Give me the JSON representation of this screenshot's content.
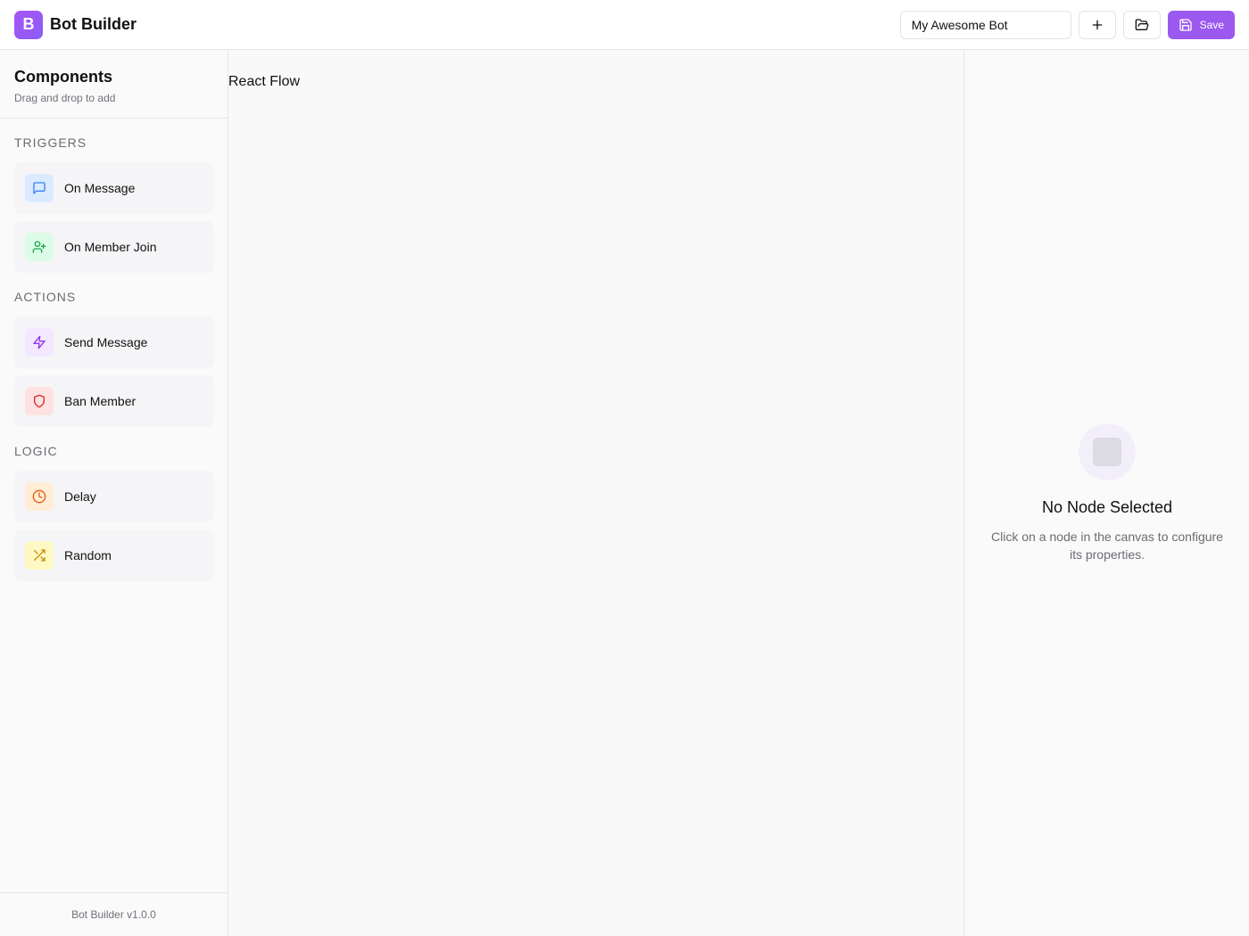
{
  "header": {
    "logo_letter": "B",
    "app_title": "Bot Builder",
    "bot_name_value": "My Awesome Bot",
    "save_label": "Save",
    "accent_color": "#9b59f0"
  },
  "sidebar": {
    "title": "Components",
    "subtitle": "Drag and drop to add",
    "sections": [
      {
        "label": "TRIGGERS",
        "items": [
          {
            "label": "On Message",
            "icon": "message-square-icon",
            "color": "#3b82f6",
            "bg": "#dbeafe"
          },
          {
            "label": "On Member Join",
            "icon": "user-plus-icon",
            "color": "#16a34a",
            "bg": "#dcfce7"
          }
        ]
      },
      {
        "label": "ACTIONS",
        "items": [
          {
            "label": "Send Message",
            "icon": "zap-icon",
            "color": "#9333ea",
            "bg": "#f3e8ff"
          },
          {
            "label": "Ban Member",
            "icon": "shield-icon",
            "color": "#dc2626",
            "bg": "#fee2e2"
          }
        ]
      },
      {
        "label": "LOGIC",
        "items": [
          {
            "label": "Delay",
            "icon": "clock-icon",
            "color": "#ea580c",
            "bg": "#ffedd5"
          },
          {
            "label": "Random",
            "icon": "shuffle-icon",
            "color": "#ca8a04",
            "bg": "#fef9c3"
          }
        ]
      }
    ],
    "footer": "Bot Builder v1.0.0"
  },
  "canvas": {
    "label": "React Flow"
  },
  "panel": {
    "empty_title": "No Node Selected",
    "empty_description": "Click on a node in the canvas to configure its properties."
  }
}
